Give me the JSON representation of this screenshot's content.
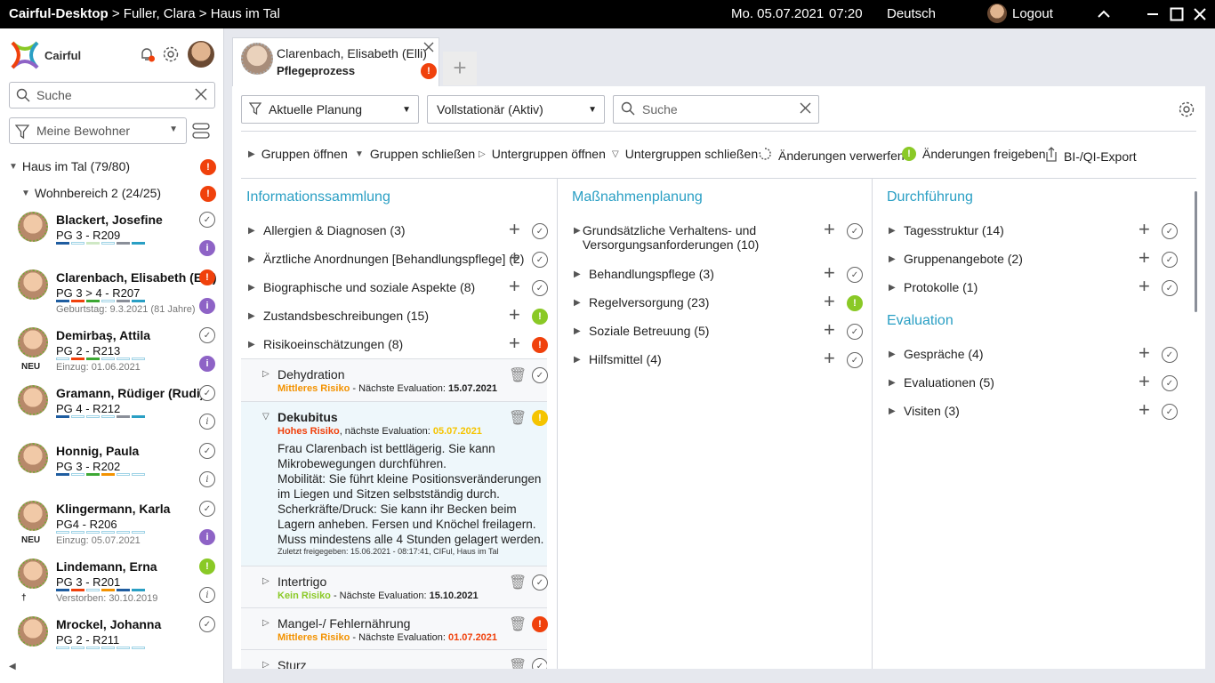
{
  "titlebar": {
    "app": "Cairful-Desktop",
    "path": " > Fuller, Clara > Haus im Tal",
    "date": "Mo. 05.07.2021",
    "time": "07:20",
    "language": "Deutsch",
    "logout": "Logout"
  },
  "sidebar": {
    "brand": "Cairful",
    "search_placeholder": "Suche",
    "filter": "Meine Bewohner",
    "group_label": "Haus im Tal (79/80)",
    "subgroup_label": "Wohnbereich 2 (24/25)",
    "residents": [
      {
        "name": "Blackert, Josefine",
        "pg": "PG 3 - R209",
        "meta": "",
        "neu": ""
      },
      {
        "name": "Clarenbach, Elisabeth (Elli)",
        "pg": "PG 3 > 4 - R207",
        "meta": "Geburtstag: 9.3.2021 (81 Jahre)",
        "neu": ""
      },
      {
        "name": "Demirbaş, Attila",
        "pg": "PG 2 - R213",
        "meta": "Einzug: 01.06.2021",
        "neu": "NEU"
      },
      {
        "name": "Gramann, Rüdiger (Rudi)",
        "pg": "PG 4 - R212",
        "meta": "",
        "neu": ""
      },
      {
        "name": "Honnig, Paula",
        "pg": "PG 3 - R202",
        "meta": "",
        "neu": ""
      },
      {
        "name": "Klingermann, Karla",
        "pg": "PG4 - R206",
        "meta": "Einzug: 05.07.2021",
        "neu": "NEU"
      },
      {
        "name": "Lindemann, Erna",
        "pg": "PG 3 - R201",
        "meta": "Verstorben: 30.10.2019",
        "neu": "†"
      },
      {
        "name": "Mrockel, Johanna",
        "pg": "PG 2 - R211",
        "meta": "",
        "neu": ""
      }
    ]
  },
  "tab": {
    "name": "Clarenbach, Elisabeth (Elli)",
    "title": "Pflegeprozess",
    "add": "+"
  },
  "filters": {
    "planning": "Aktuelle Planung",
    "status": "Vollstationär (Aktiv)",
    "search_placeholder": "Suche"
  },
  "toolbar": {
    "open_groups": "Gruppen öffnen",
    "close_groups": "Gruppen schließen",
    "open_subgroups": "Untergruppen öffnen",
    "close_subgroups": "Untergruppen schließen",
    "discard": "Änderungen verwerfen",
    "release": "Änderungen freigeben",
    "export": "BI-/QI-Export"
  },
  "col1": {
    "title": "Informationssammlung",
    "items": [
      "Allergien & Diagnosen (3)",
      "Ärztliche Anordnungen [Behandlungspflege] (2)",
      "Biographische und soziale Aspekte (8)",
      "Zustandsbeschreibungen (15)",
      "Risikoeinschätzungen (8)"
    ],
    "risks": [
      {
        "title": "Dehydration",
        "level": "Mittleres Risiko",
        "sep": " - Nächste Evaluation: ",
        "date": "15.07.2021"
      },
      {
        "title": "Dekubitus",
        "level": "Hohes Risiko",
        "sep": ", nächste Evaluation: ",
        "date": "05.07.2021",
        "text": "Frau Clarenbach ist bettlägerig. Sie kann Mikrobewegungen durchführen.\nMobilität: Sie führt kleine Positionsveränderungen im Liegen und Sitzen selbstständig durch.\nScherkräfte/Druck: Sie kann ihr Becken beim Lagern anheben. Fersen und Knöchel freilagern.\nMuss mindestens alle 4 Stunden gelagert werden.",
        "footer": "Zuletzt freigegeben: 15.06.2021 - 08:17:41, CIFul, Haus im Tal"
      },
      {
        "title": "Intertrigo",
        "level": "Kein Risiko",
        "sep": " - Nächste Evaluation: ",
        "date": "15.10.2021"
      },
      {
        "title": "Mangel-/ Fehlernährung",
        "level": "Mittleres Risiko",
        "sep": " - Nächste Evaluation: ",
        "date": "01.07.2021"
      },
      {
        "title": "Sturz",
        "level": "",
        "sep": "",
        "date": ""
      }
    ]
  },
  "col2": {
    "title": "Maßnahmenplanung",
    "items": [
      "Grundsätzliche Verhaltens- und Versorgungsanforderungen (10)",
      "Behandlungspflege (3)",
      "Regelversorgung (23)",
      "Soziale Betreuung (5)",
      "Hilfsmittel (4)"
    ]
  },
  "col3": {
    "title": "Durchführung",
    "items": [
      "Tagesstruktur (14)",
      "Gruppenangebote (2)",
      "Protokolle (1)"
    ],
    "title2": "Evaluation",
    "items2": [
      "Gespräche (4)",
      "Evaluationen (5)",
      "Visiten (3)"
    ]
  },
  "colors": {
    "accent": "#2a9fc4",
    "red": "#f0410c",
    "green": "#8ac926",
    "yellow": "#f5c400",
    "purple": "#8e63c6",
    "orange": "#f39200"
  }
}
